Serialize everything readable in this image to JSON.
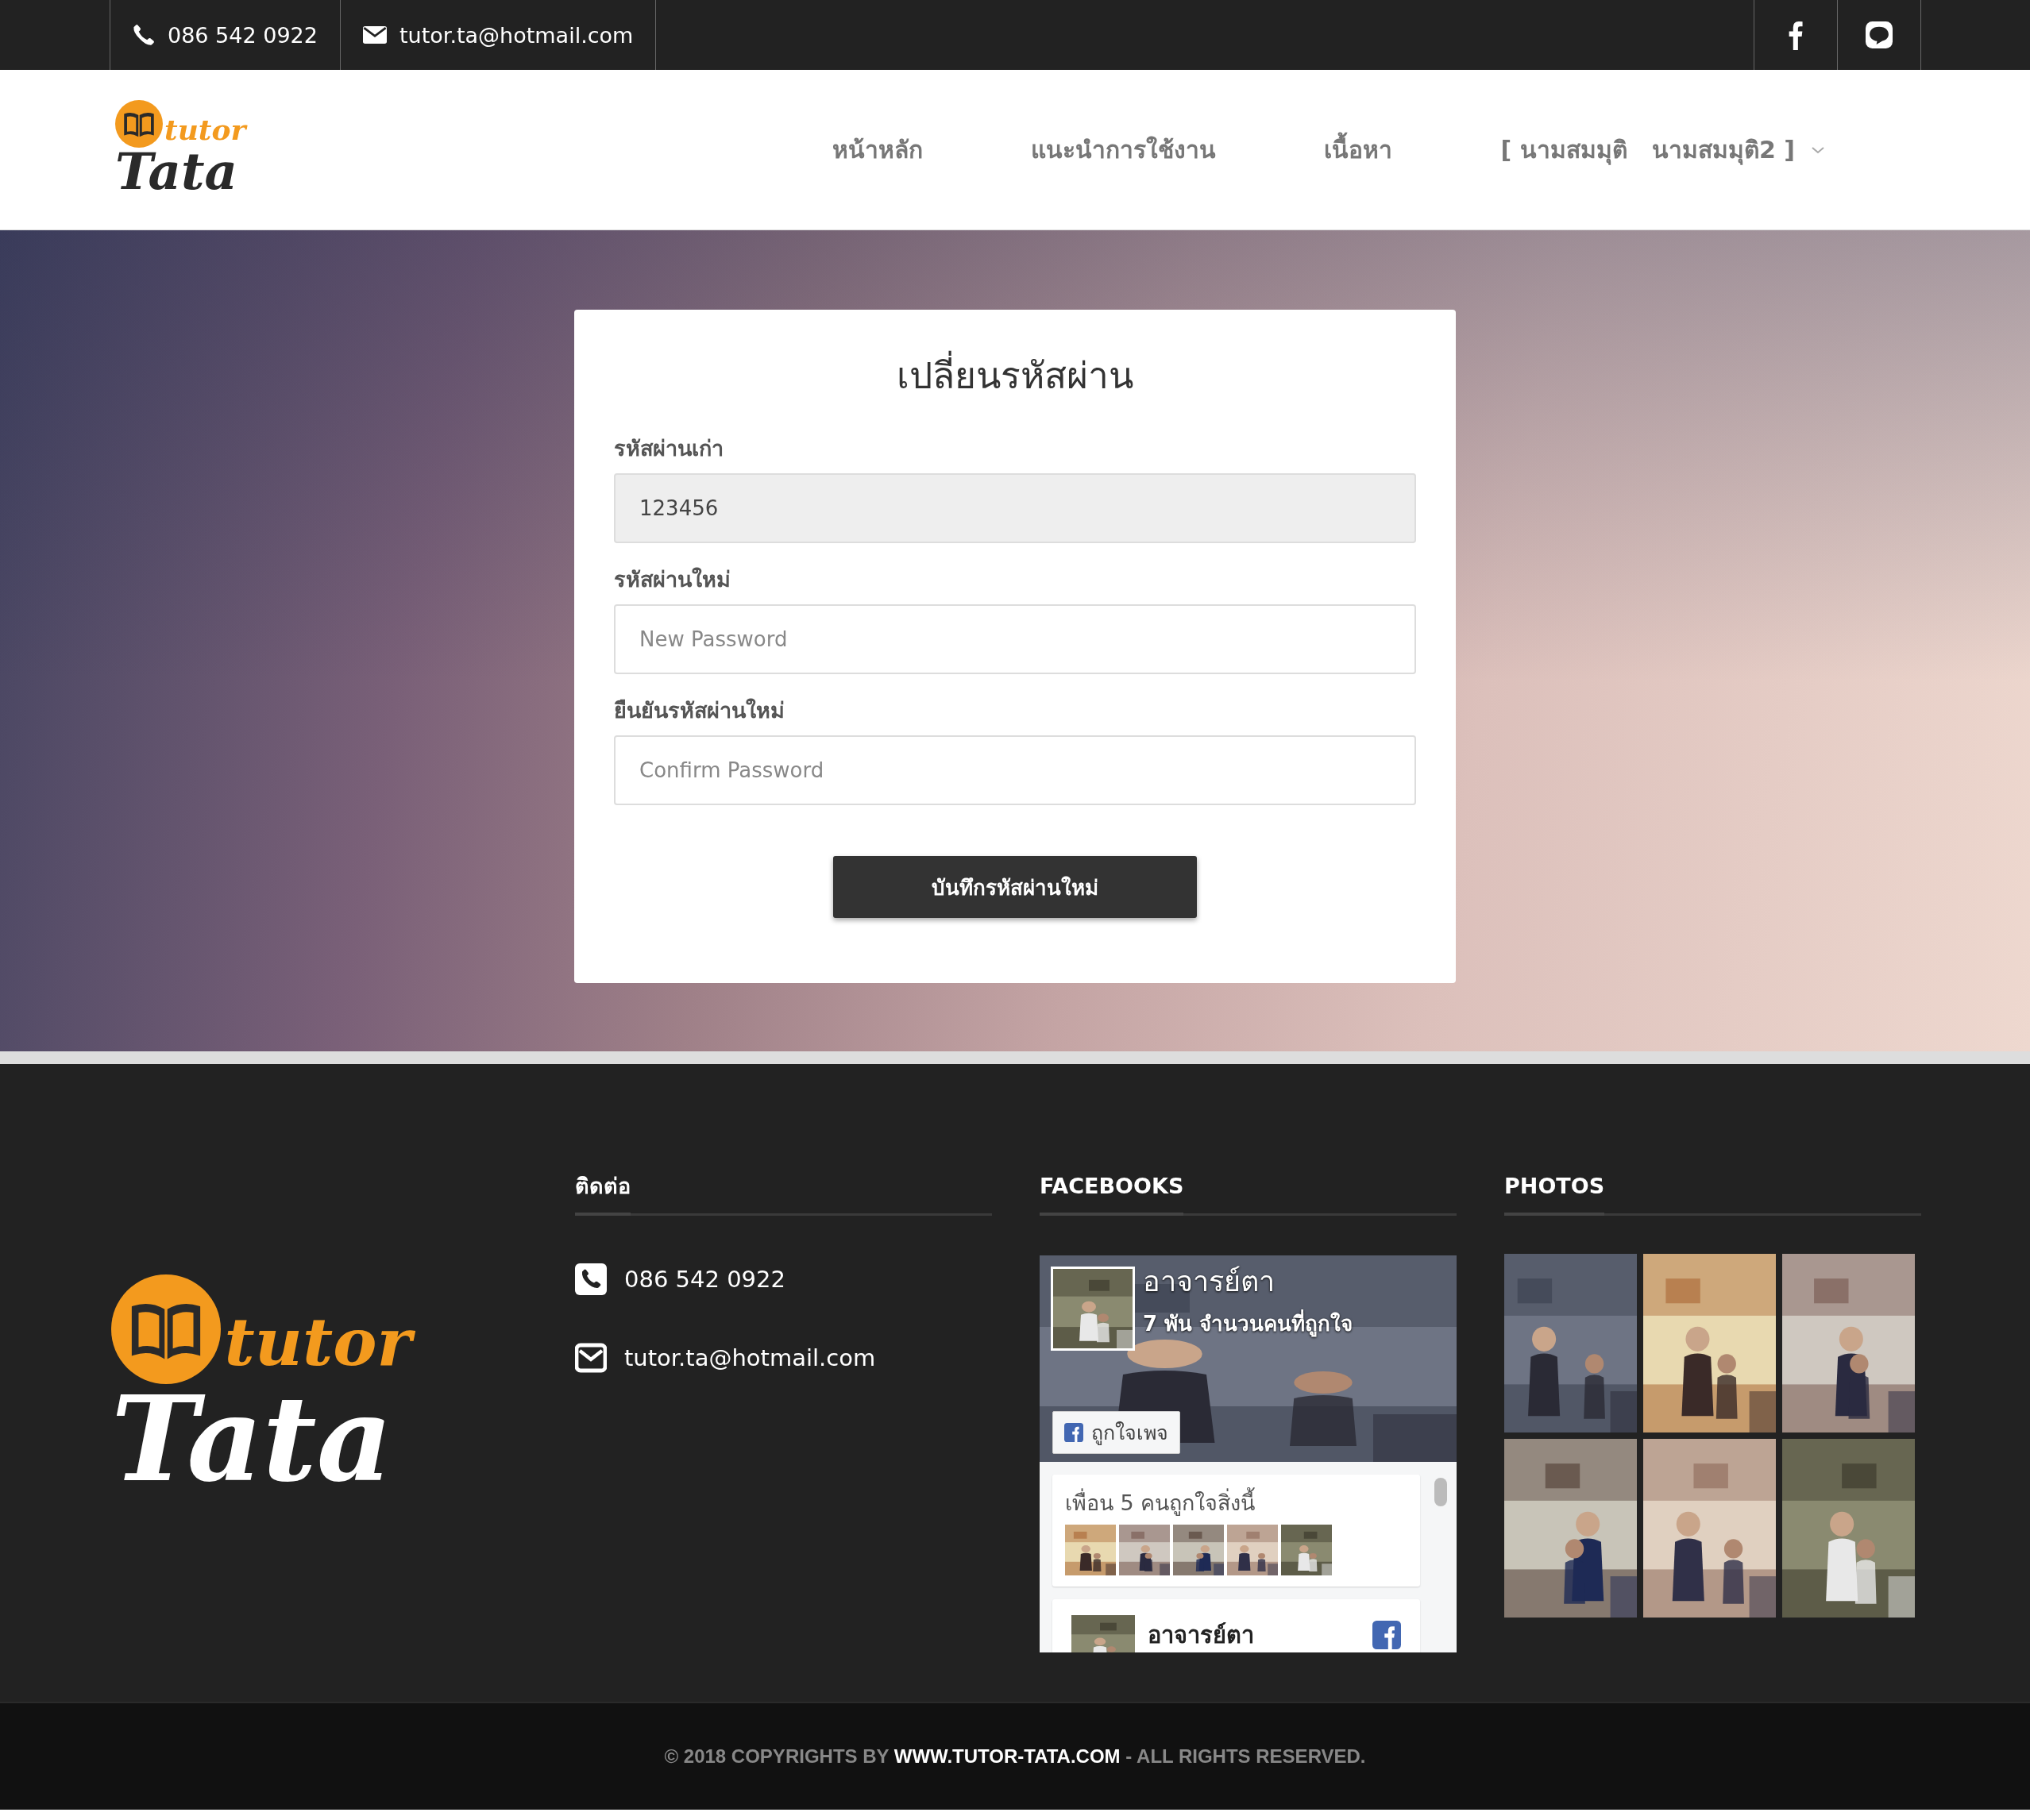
{
  "top_bar": {
    "phone": "086 542 0922",
    "email": "tutor.ta@hotmail.com",
    "social": [
      {
        "kind": "facebook"
      },
      {
        "kind": "line"
      }
    ]
  },
  "logo": {
    "small": "tutor",
    "large": "Tata"
  },
  "nav": {
    "items": [
      {
        "label": "หน้าหลัก",
        "kind": "link"
      },
      {
        "label": "แนะนำการใช้งาน",
        "kind": "link"
      },
      {
        "label": "เนื้อหา",
        "kind": "link"
      },
      {
        "label": "[ นามสมมุติ   นามสมมุติ2 ]",
        "kind": "dropdown"
      }
    ]
  },
  "form": {
    "title": "เปลี่ยนรหัสผ่าน",
    "fields": [
      {
        "label": "รหัสผ่านเก่า",
        "value": "123456",
        "disabled": true
      },
      {
        "label": "รหัสผ่านใหม่",
        "placeholder": "New Password",
        "disabled": false
      },
      {
        "label": "ยืนยันรหัสผ่านใหม่",
        "placeholder": "Confirm Password",
        "disabled": false
      }
    ],
    "submit": "บันทึกรหัสผ่านใหม่"
  },
  "footer": {
    "logo": {
      "small": "tutor",
      "large": "Tata"
    },
    "contact": {
      "heading": "ติดต่อ",
      "phone": "086 542 0922",
      "email": "tutor.ta@hotmail.com"
    },
    "facebook": {
      "heading": "FACEBOOKS",
      "page_name": "อาจารย์ตา",
      "likes": "7 พัน จำนวนคนที่ถูกใจ",
      "like_button": "ถูกใจเพจ",
      "friends": "เพื่อน 5 คนถูกใจสิ่งนี้",
      "post_author": "อาจารย์ตา"
    },
    "photos": {
      "heading": "PHOTOS"
    }
  },
  "copyright": {
    "before": "© 2018 COPYRIGHTS BY",
    "site": "WWW.TUTOR-TATA.COM",
    "after": "- ALL RIGHTS RESERVED."
  }
}
